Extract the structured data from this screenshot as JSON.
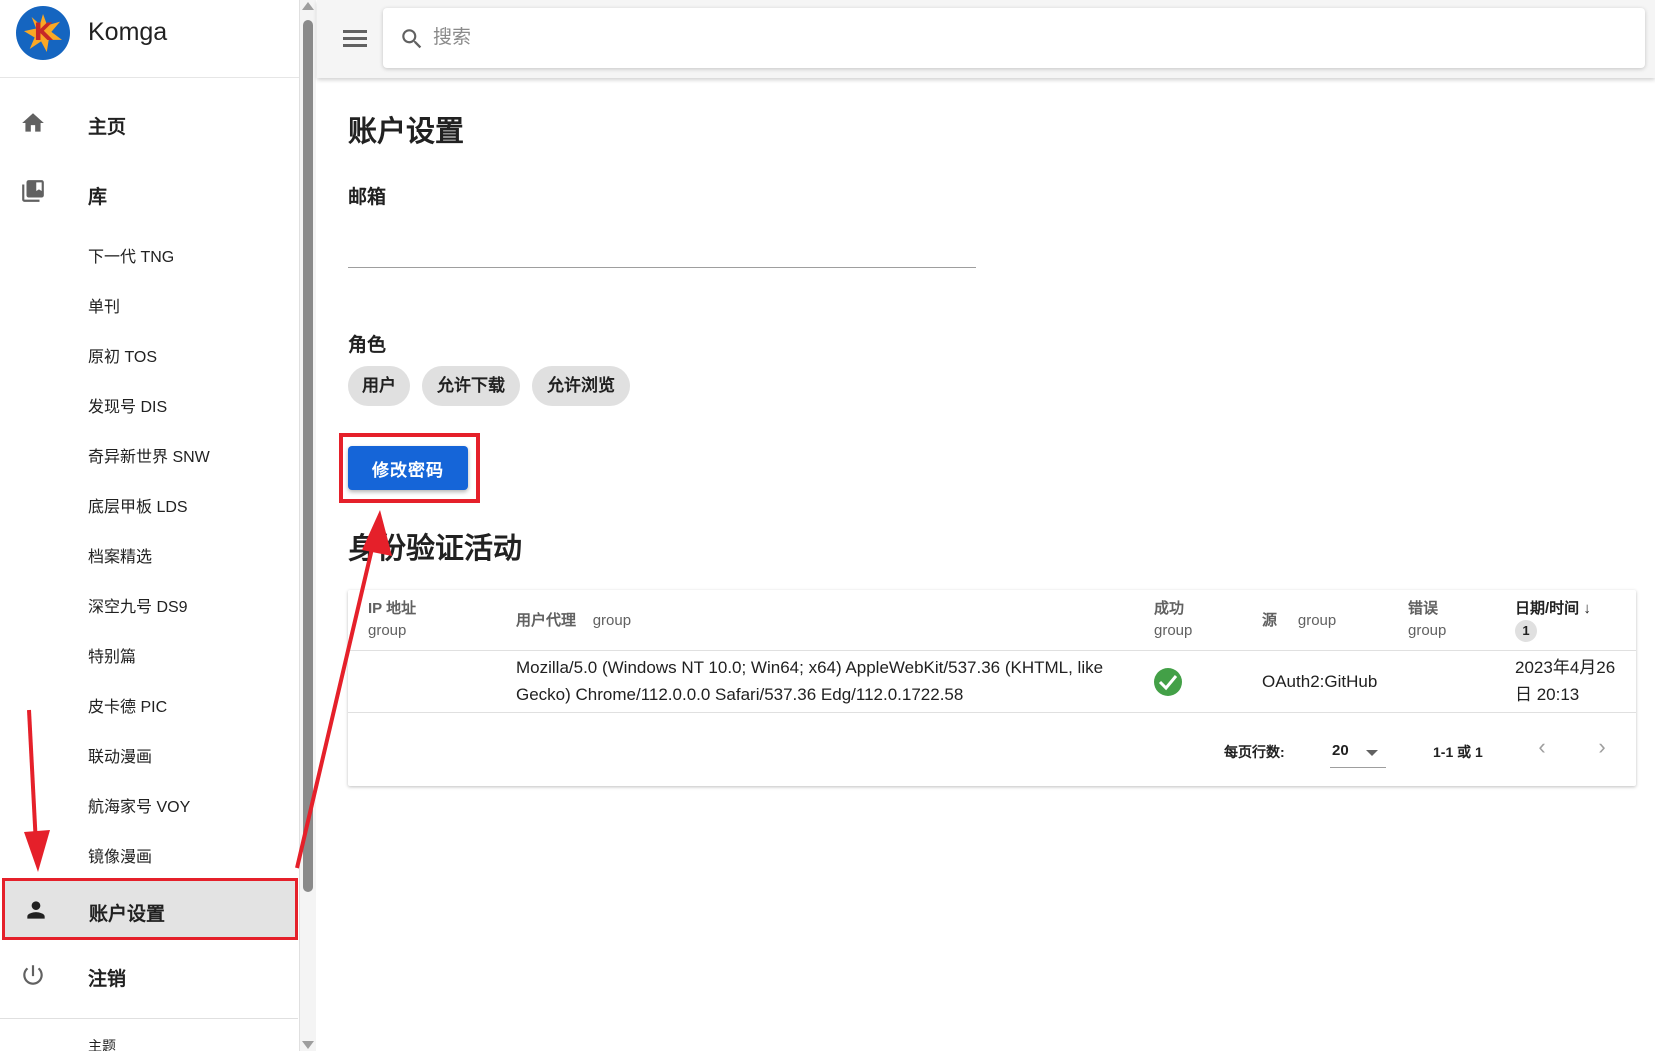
{
  "app": {
    "name": "Komga"
  },
  "search": {
    "placeholder": "搜索"
  },
  "sidebar": {
    "home": "主页",
    "libraries": "库",
    "library_items": [
      "下一代 TNG",
      "单刊",
      "原初 TOS",
      "发现号 DIS",
      "奇异新世界 SNW",
      "底层甲板 LDS",
      "档案精选",
      "深空九号 DS9",
      "特别篇",
      "皮卡德 PIC",
      "联动漫画",
      "航海家号 VOY",
      "镜像漫画"
    ],
    "account": "账户设置",
    "logout": "注销",
    "theme": "主题"
  },
  "main": {
    "title": "账户设置",
    "email_label": "邮箱",
    "email_value": "",
    "roles_label": "角色",
    "roles": [
      "用户",
      "允许下载",
      "允许浏览"
    ],
    "change_password": "修改密码",
    "activity_title": "身份验证活动"
  },
  "table": {
    "headers": {
      "ip": "IP 地址",
      "ip_group": "group",
      "user_agent": "用户代理",
      "user_agent_group": "group",
      "success": "成功",
      "success_group": "group",
      "source": "源",
      "source_group": "group",
      "error": "错误",
      "error_group": "group",
      "datetime": "日期/时间 ↓",
      "sort_order": "1"
    },
    "rows": [
      {
        "ip": "",
        "user_agent_line1": "Mozilla/5.0 (Windows NT 10.0; Win64; x64) AppleWebKit/537.36 (KHTML, like",
        "user_agent_line2": "Gecko) Chrome/112.0.0.0 Safari/537.36 Edg/112.0.1722.58",
        "success": true,
        "source": "OAuth2:GitHub",
        "error": "",
        "datetime_line1": "2023年4月26",
        "datetime_line2": "日 20:13"
      }
    ],
    "footer": {
      "rows_per_page_label": "每页行数:",
      "rows_per_page": "20",
      "range": "1-1 或 1"
    }
  },
  "colors": {
    "primary": "#1565d8",
    "annotation_red": "#e5202a",
    "success_green": "#43a047",
    "active_bg": "#e3e3e3"
  },
  "icons": [
    "home-icon",
    "library-icon",
    "account-icon",
    "power-icon",
    "search-icon",
    "menu-icon",
    "check-circle-icon",
    "chevron-left-icon",
    "chevron-right-icon",
    "dropdown-caret-icon"
  ]
}
